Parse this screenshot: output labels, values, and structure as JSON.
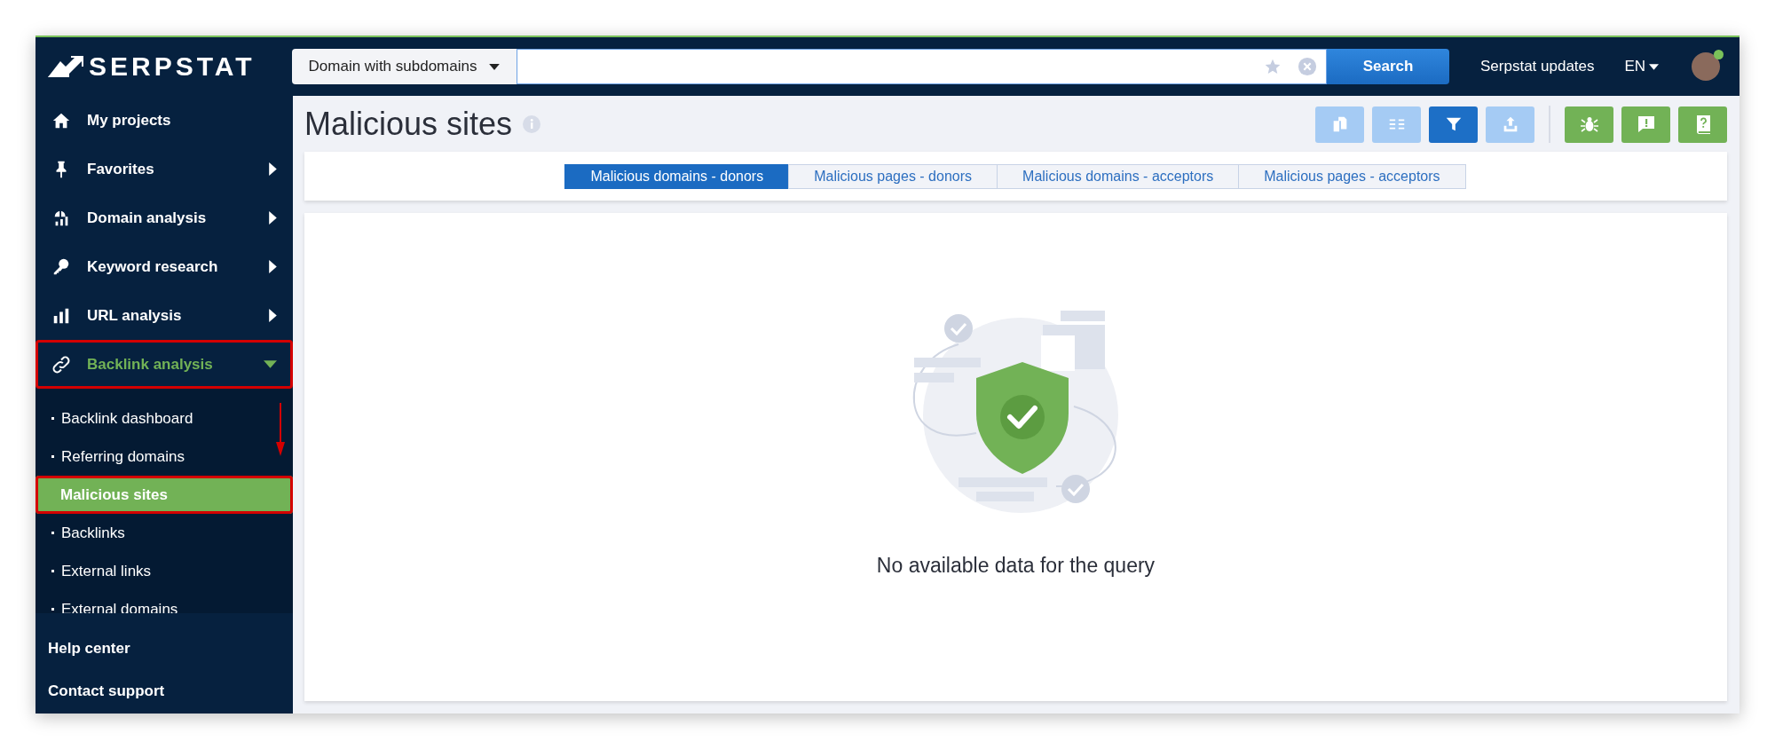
{
  "header": {
    "logo": "SERPSTAT",
    "search_scope": "Domain with subdomains",
    "search_button": "Search",
    "updates_link": "Serpstat updates",
    "language": "EN",
    "user": {
      "online": true
    }
  },
  "sidebar": {
    "items": [
      {
        "label": "My projects",
        "kind": "link",
        "selected": false,
        "highlighted": false
      },
      {
        "label": "Favorites",
        "kind": "section",
        "expanded": false,
        "selected": false,
        "highlighted": false
      },
      {
        "label": "Domain analysis",
        "kind": "section",
        "expanded": false,
        "selected": false,
        "highlighted": false
      },
      {
        "label": "Keyword research",
        "kind": "section",
        "expanded": false,
        "selected": false,
        "highlighted": false
      },
      {
        "label": "URL analysis",
        "kind": "section",
        "expanded": false,
        "selected": false,
        "highlighted": false
      },
      {
        "label": "Backlink analysis",
        "kind": "section",
        "expanded": true,
        "selected": true,
        "highlighted": true,
        "children": [
          {
            "label": "Backlink dashboard",
            "selected": false,
            "highlighted": false
          },
          {
            "label": "Referring domains",
            "selected": false,
            "highlighted": false
          },
          {
            "label": "Malicious sites",
            "selected": true,
            "highlighted": true
          },
          {
            "label": "Backlinks",
            "selected": false,
            "highlighted": false
          },
          {
            "label": "External links",
            "selected": false,
            "highlighted": false
          },
          {
            "label": "External domains",
            "selected": false,
            "highlighted": false
          }
        ]
      }
    ],
    "footer_links": [
      "Help center",
      "Contact support"
    ]
  },
  "page": {
    "title": "Malicious sites",
    "toolbar": [
      {
        "kind": "view",
        "active": false
      },
      {
        "kind": "view",
        "active": false
      },
      {
        "kind": "view",
        "active": true
      },
      {
        "kind": "view",
        "active": false
      },
      {
        "kind": "help"
      },
      {
        "kind": "help"
      },
      {
        "kind": "help"
      }
    ],
    "tabs": [
      {
        "label": "Malicious domains - donors",
        "selected": true
      },
      {
        "label": "Malicious pages - donors",
        "selected": false
      },
      {
        "label": "Malicious domains - acceptors",
        "selected": false
      },
      {
        "label": "Malicious pages - acceptors",
        "selected": false
      }
    ],
    "empty_message": "No available data for the query"
  }
}
